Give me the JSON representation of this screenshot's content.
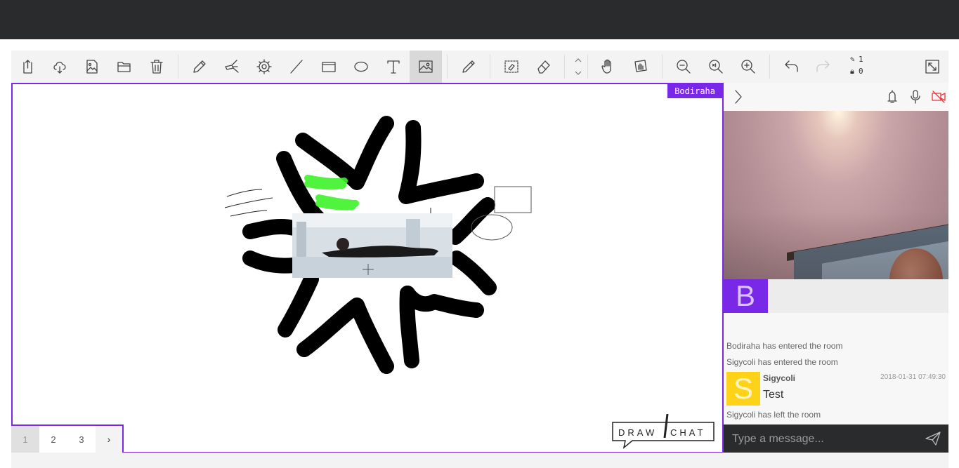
{
  "toolbar": {
    "tools": [
      {
        "name": "export-button",
        "icon": "export-icon"
      },
      {
        "name": "upload-cloud-button",
        "icon": "cloud-upload-icon"
      },
      {
        "name": "save-image-button",
        "icon": "image-file-icon"
      },
      {
        "name": "open-folder-button",
        "icon": "folder-icon"
      },
      {
        "name": "trash-button",
        "icon": "trash-icon"
      },
      {
        "name": "pencil-tool",
        "icon": "pencil-icon"
      },
      {
        "name": "highlighter-tool",
        "icon": "highlighter-icon"
      },
      {
        "name": "settings-tool",
        "icon": "gear-icon"
      },
      {
        "name": "line-tool",
        "icon": "line-icon"
      },
      {
        "name": "rectangle-tool",
        "icon": "rectangle-icon"
      },
      {
        "name": "ellipse-tool",
        "icon": "ellipse-icon"
      },
      {
        "name": "text-tool",
        "icon": "text-icon"
      },
      {
        "name": "image-tool",
        "icon": "image-icon"
      },
      {
        "name": "eyedropper-tool",
        "icon": "eyedropper-icon"
      },
      {
        "name": "select-eraser-tool",
        "icon": "select-eraser-icon"
      },
      {
        "name": "eraser-tool",
        "icon": "eraser-icon"
      },
      {
        "name": "hand-tool",
        "icon": "hand-icon"
      },
      {
        "name": "drag-page-tool",
        "icon": "drag-page-icon"
      },
      {
        "name": "zoom-out-button",
        "icon": "zoom-out-icon"
      },
      {
        "name": "zoom-reset-button",
        "icon": "zoom-reset-icon"
      },
      {
        "name": "zoom-in-button",
        "icon": "zoom-in-icon"
      },
      {
        "name": "undo-button",
        "icon": "undo-icon"
      },
      {
        "name": "redo-button",
        "icon": "redo-icon"
      },
      {
        "name": "fullscreen-button",
        "icon": "fullscreen-icon"
      }
    ],
    "active_tool": "image-tool",
    "pen_count": "1",
    "lock_count": "0"
  },
  "canvas": {
    "user_label": "Bodiraha",
    "border_color": "#7a28e8"
  },
  "pages": {
    "items": [
      "1",
      "2",
      "3"
    ],
    "current": "1",
    "next_symbol": "›"
  },
  "logo": {
    "text_left": "DRAW",
    "text_right": "CHAT"
  },
  "sidepanel": {
    "toggle_icon": "chevron-right-icon",
    "icons": [
      "bell-icon",
      "microphone-icon",
      "video-off-icon"
    ],
    "self_avatar_letter": "B",
    "self_avatar_color": "#7a28e8"
  },
  "chat": {
    "system_messages": [
      "Bodiraha has entered the room",
      "Sigycoli has entered the room",
      "Sigycoli has left the room"
    ],
    "message": {
      "avatar_letter": "S",
      "avatar_color": "#ffd21a",
      "author": "Sigycoli",
      "timestamp": "2018-01-31 07:49:30",
      "text": "Test"
    },
    "input_placeholder": "Type a message..."
  }
}
